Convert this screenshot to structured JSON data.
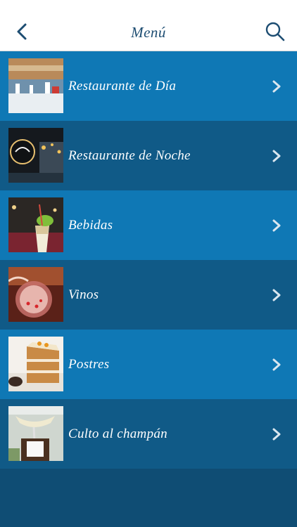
{
  "header": {
    "title": "Menú",
    "back_icon": "chevron-left-icon",
    "search_icon": "search-icon"
  },
  "colors": {
    "header_bg": "#ffffff",
    "title_color": "#1d4d72",
    "row_light": "#0f78b5",
    "row_dark": "#105a87",
    "background": "#0f4d74"
  },
  "menu": {
    "items": [
      {
        "label": "Restaurante de Día",
        "image": "day-restaurant-photo"
      },
      {
        "label": "Restaurante de Noche",
        "image": "night-restaurant-photo"
      },
      {
        "label": "Bebidas",
        "image": "drinks-photo"
      },
      {
        "label": "Vinos",
        "image": "wine-photo"
      },
      {
        "label": "Postres",
        "image": "desserts-photo"
      },
      {
        "label": "Culto al champán",
        "image": "champagne-photo"
      }
    ]
  }
}
